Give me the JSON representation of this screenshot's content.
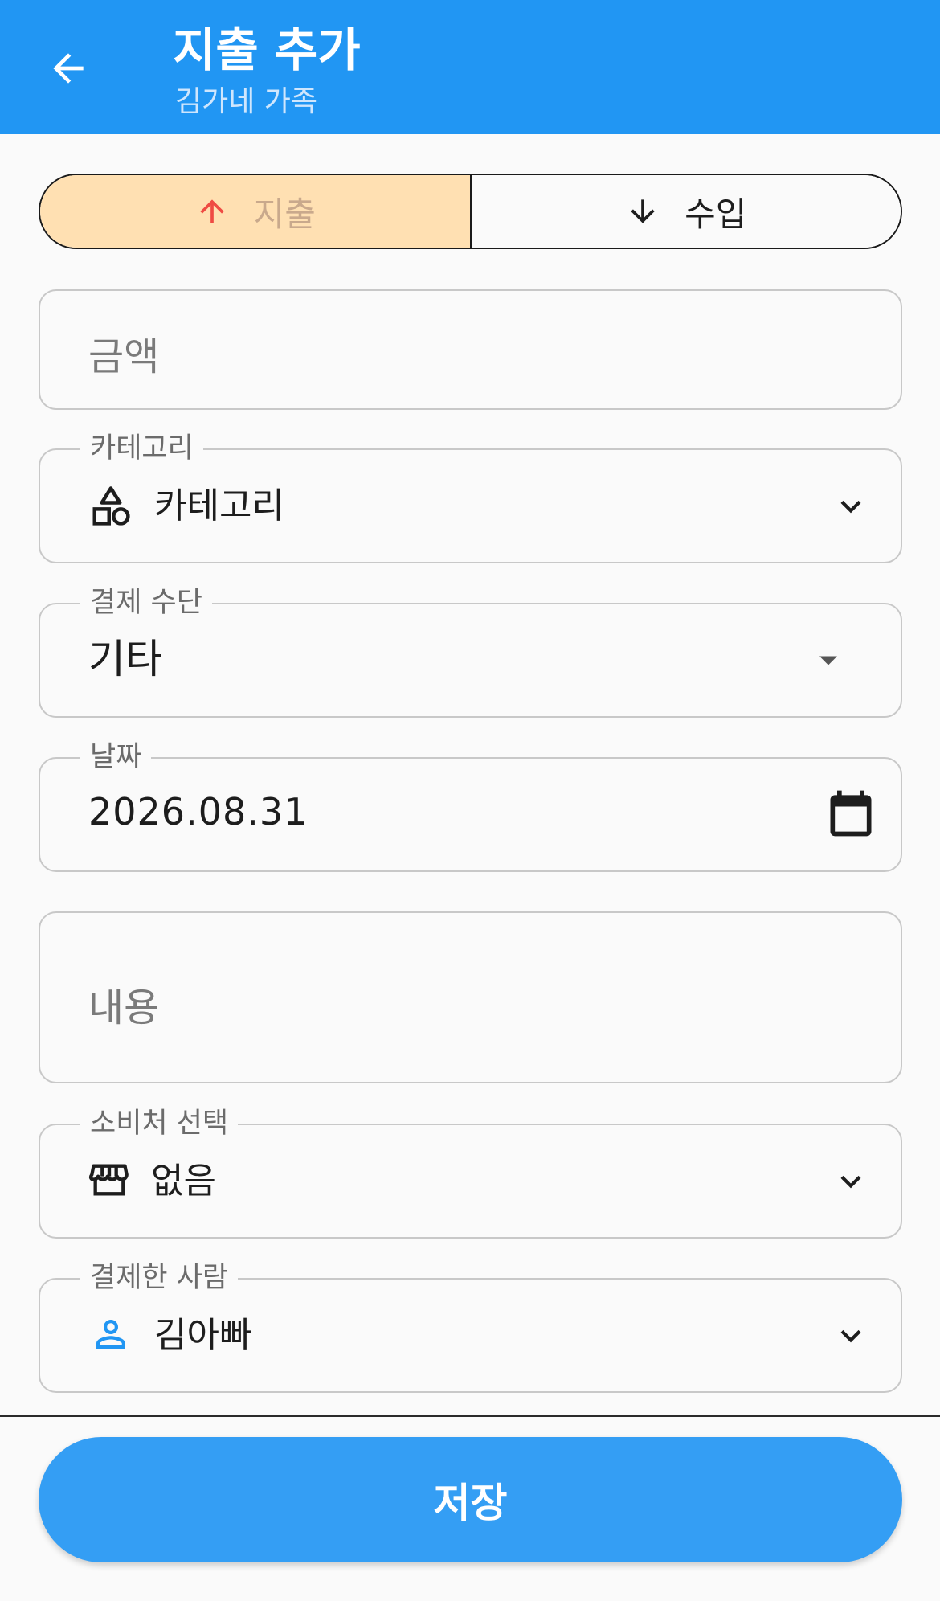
{
  "appbar": {
    "title": "지출 추가",
    "subtitle": "김가네 가족",
    "back_icon": "arrow-left-icon",
    "color": "#2196f3"
  },
  "type_toggle": {
    "expense_label": "지출",
    "income_label": "수입",
    "selected": "expense",
    "expense_icon": "arrow-up-icon",
    "income_icon": "arrow-down-icon",
    "selected_bg": "#ffe0b2"
  },
  "amount": {
    "placeholder": "금액"
  },
  "category": {
    "label": "카테고리",
    "value": "카테고리",
    "icon": "category-shapes-icon"
  },
  "payment_method": {
    "label": "결제 수단",
    "value": "기타"
  },
  "date": {
    "label": "날짜",
    "value": "2026.08.31",
    "icon": "calendar-icon"
  },
  "description": {
    "placeholder": "내용"
  },
  "merchant": {
    "label": "소비처 선택",
    "value": "없음",
    "icon": "store-icon"
  },
  "payer": {
    "label": "결제한 사람",
    "value": "김아빠",
    "icon": "person-icon",
    "icon_color": "#2196f3"
  },
  "save_button": {
    "label": "저장",
    "color": "#349ef4"
  }
}
